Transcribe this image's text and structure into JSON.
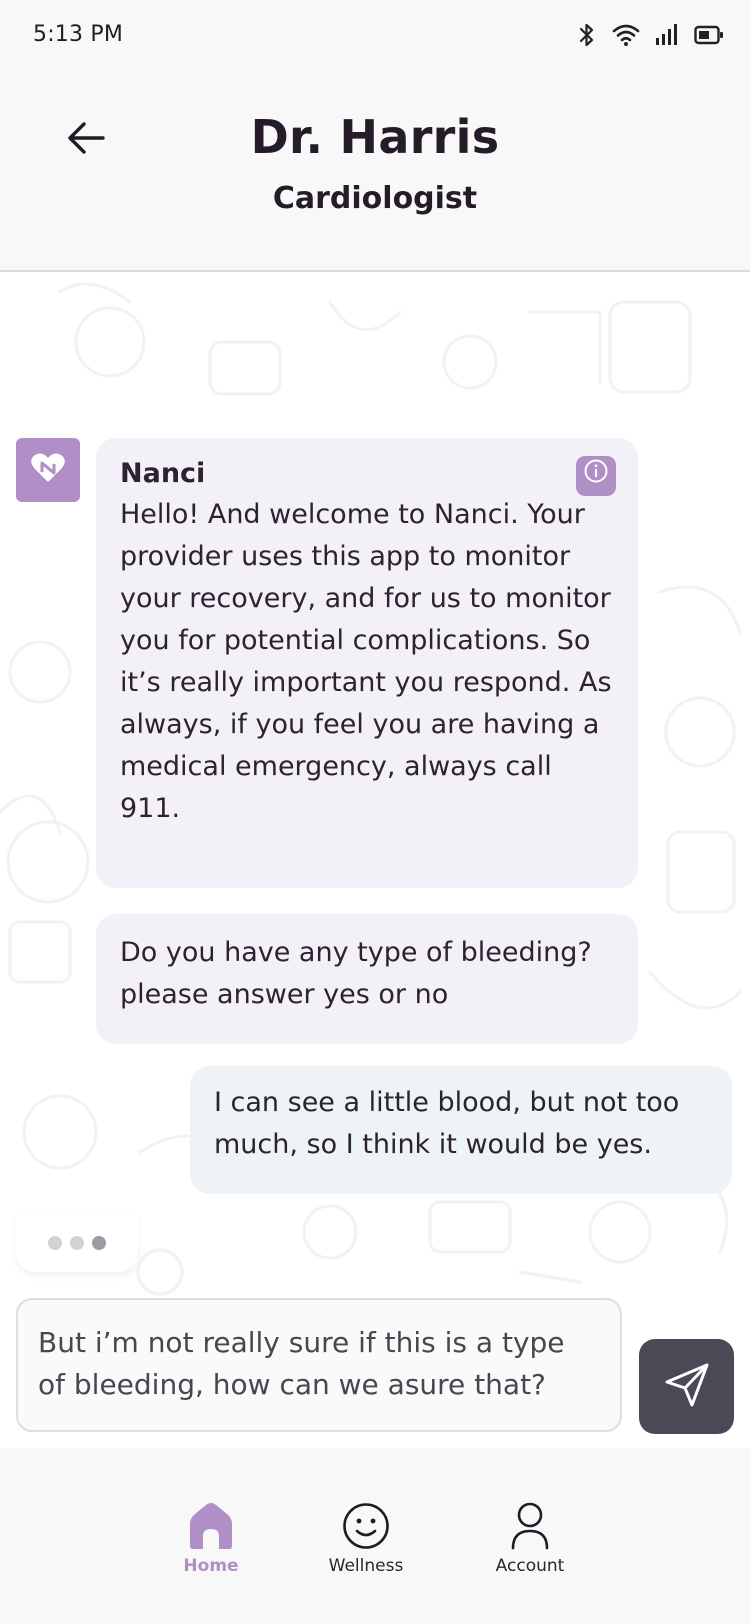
{
  "status_bar": {
    "time": "5:13 PM",
    "icons": [
      "bluetooth-icon",
      "wifi-icon",
      "signal-icon",
      "battery-icon"
    ]
  },
  "header": {
    "title": "Dr. Harris",
    "subtitle": "Cardiologist",
    "back_icon": "arrow-left-icon"
  },
  "chat": {
    "messages": [
      {
        "from": "bot",
        "sender": "Nanci",
        "text": "Hello! And welcome to Nanci. Your provider uses this app to monitor your recovery, and for us to monitor you for potential complications. So it’s really important you respond. As always, if you feel you are having a medical emergency, always call 911."
      },
      {
        "from": "bot",
        "text": "Do you have any type of bleeding? please answer yes or no"
      },
      {
        "from": "user",
        "text": "I can see a little blood, but not too much, so I think it would be yes."
      }
    ],
    "typing": true
  },
  "composer": {
    "value": "But i’m not really sure if this is a type of bleeding, how can we asure that?",
    "send_icon": "send-icon"
  },
  "nav": {
    "items": [
      {
        "label": "Home",
        "icon": "home-icon",
        "active": true
      },
      {
        "label": "Wellness",
        "icon": "smiley-icon",
        "active": false
      },
      {
        "label": "Account",
        "icon": "person-icon",
        "active": false
      }
    ]
  },
  "colors": {
    "accent": "#b08ec6",
    "bot_bubble": "#f3f0f8",
    "user_bubble": "#edf3f6",
    "send_button": "#4d4856"
  }
}
